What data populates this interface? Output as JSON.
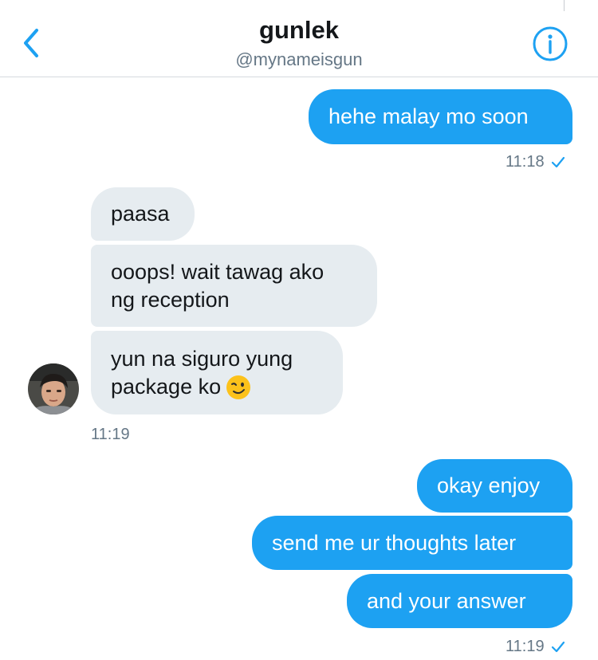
{
  "header": {
    "name": "gunlek",
    "handle": "@mynameisgun"
  },
  "icons": {
    "back": "chevron-left-icon",
    "info": "info-icon",
    "read": "checkmark-icon",
    "emoji": "winking-face-emoji"
  },
  "colors": {
    "accent": "#1da1f2",
    "incoming_bubble": "#e6ecf0",
    "timestamp": "#657786"
  },
  "messages": [
    {
      "direction": "outgoing",
      "text": "hehe malay mo soon"
    },
    {
      "direction": "incoming",
      "text": "paasa"
    },
    {
      "direction": "incoming",
      "lines": [
        "ooops! wait tawag ako",
        "ng reception"
      ]
    },
    {
      "direction": "incoming",
      "lines": [
        "yun na siguro yung",
        "package ko"
      ],
      "emoji": "😉"
    },
    {
      "direction": "outgoing",
      "text": "okay enjoy"
    },
    {
      "direction": "outgoing",
      "text": "send me ur thoughts later"
    },
    {
      "direction": "outgoing",
      "text": "and your answer"
    }
  ],
  "timestamps": {
    "first": "11:18",
    "second": "11:19",
    "third": "11:19"
  }
}
